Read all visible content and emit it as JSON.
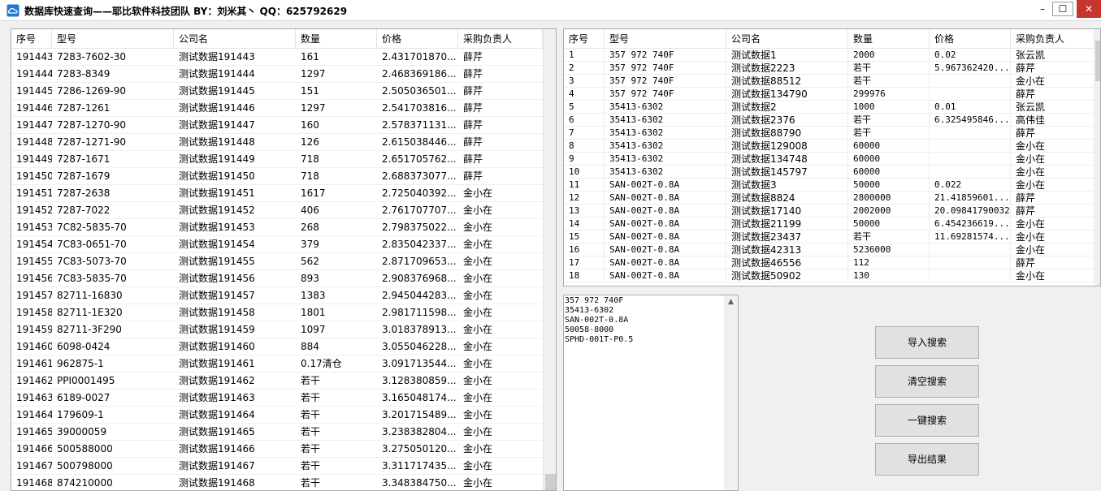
{
  "window": {
    "title": "数据库快速查询——耶比软件科技团队 BY：刘米其丶 QQ：625792629",
    "minimize": "–",
    "maximize": "☐",
    "close": "✕"
  },
  "left_grid": {
    "columns": [
      "序号",
      "型号",
      "公司名",
      "数量",
      "价格",
      "采购负责人"
    ],
    "rows": [
      [
        "191443",
        "7283-7602-30",
        "测试数据191443",
        "161",
        "2.431701870...",
        "薛芹"
      ],
      [
        "191444",
        "7283-8349",
        "测试数据191444",
        "1297",
        "2.468369186...",
        "薛芹"
      ],
      [
        "191445",
        "7286-1269-90",
        "测试数据191445",
        "151",
        "2.505036501...",
        "薛芹"
      ],
      [
        "191446",
        "7287-1261",
        "测试数据191446",
        "1297",
        "2.541703816...",
        "薛芹"
      ],
      [
        "191447",
        "7287-1270-90",
        "测试数据191447",
        "160",
        "2.578371131...",
        "薛芹"
      ],
      [
        "191448",
        "7287-1271-90",
        "测试数据191448",
        "126",
        "2.615038446...",
        "薛芹"
      ],
      [
        "191449",
        "7287-1671",
        "测试数据191449",
        "718",
        "2.651705762...",
        "薛芹"
      ],
      [
        "191450",
        "7287-1679",
        "测试数据191450",
        "718",
        "2.688373077...",
        "薛芹"
      ],
      [
        "191451",
        "7287-2638",
        "测试数据191451",
        "1617",
        "2.725040392...",
        "金小在"
      ],
      [
        "191452",
        "7287-7022",
        "测试数据191452",
        "406",
        "2.761707707...",
        "金小在"
      ],
      [
        "191453",
        "7C82-5835-70",
        "测试数据191453",
        "268",
        "2.798375022...",
        "金小在"
      ],
      [
        "191454",
        "7C83-0651-70",
        "测试数据191454",
        "379",
        "2.835042337...",
        "金小在"
      ],
      [
        "191455",
        "7C83-5073-70",
        "测试数据191455",
        "562",
        "2.871709653...",
        "金小在"
      ],
      [
        "191456",
        "7C83-5835-70",
        "测试数据191456",
        "893",
        "2.908376968...",
        "金小在"
      ],
      [
        "191457",
        "82711-16830",
        "测试数据191457",
        "1383",
        "2.945044283...",
        "金小在"
      ],
      [
        "191458",
        "82711-1E320",
        "测试数据191458",
        "1801",
        "2.981711598...",
        "金小在"
      ],
      [
        "191459",
        "82711-3F290",
        "测试数据191459",
        "1097",
        "3.018378913...",
        "金小在"
      ],
      [
        "191460",
        "6098-0424",
        "测试数据191460",
        "884",
        "3.055046228...",
        "金小在"
      ],
      [
        "191461",
        "962875-1",
        "测试数据191461",
        "0.17清仓",
        "3.091713544...",
        "金小在"
      ],
      [
        "191462",
        "PPI0001495",
        "测试数据191462",
        "若干",
        "3.128380859...",
        "金小在"
      ],
      [
        "191463",
        "6189-0027",
        "测试数据191463",
        "若干",
        "3.165048174...",
        "金小在"
      ],
      [
        "191464",
        "179609-1",
        "测试数据191464",
        "若干",
        "3.201715489...",
        "金小在"
      ],
      [
        "191465",
        "39000059",
        "测试数据191465",
        "若干",
        "3.238382804...",
        "金小在"
      ],
      [
        "191466",
        "500588000",
        "测试数据191466",
        "若干",
        "3.275050120...",
        "金小在"
      ],
      [
        "191467",
        "500798000",
        "测试数据191467",
        "若干",
        "3.311717435...",
        "金小在"
      ],
      [
        "191468",
        "874210000",
        "测试数据191468",
        "若干",
        "3.348384750...",
        "金小在"
      ]
    ]
  },
  "right_grid": {
    "columns": [
      "序号",
      "型号",
      "公司名",
      "数量",
      "价格",
      "采购负责人"
    ],
    "rows": [
      [
        "1",
        "357 972 740F",
        "测试数据1",
        "2000",
        "0.02",
        "张云凯"
      ],
      [
        "2",
        "357 972 740F",
        "测试数据2223",
        "若干",
        "5.967362420...",
        "薛芹"
      ],
      [
        "3",
        "357 972 740F",
        "测试数据88512",
        "若干",
        "",
        "金小在"
      ],
      [
        "4",
        "357 972 740F",
        "测试数据134790",
        "299976",
        "",
        "薛芹"
      ],
      [
        "5",
        "35413-6302",
        "测试数据2",
        "1000",
        "0.01",
        "张云凯"
      ],
      [
        "6",
        "35413-6302",
        "测试数据2376",
        "若干",
        "6.325495846...",
        "高伟佳"
      ],
      [
        "7",
        "35413-6302",
        "测试数据88790",
        "若干",
        "",
        "薛芹"
      ],
      [
        "8",
        "35413-6302",
        "测试数据129008",
        "60000",
        "",
        "金小在"
      ],
      [
        "9",
        "35413-6302",
        "测试数据134748",
        "60000",
        "",
        "金小在"
      ],
      [
        "10",
        "35413-6302",
        "测试数据145797",
        "60000",
        "",
        "金小在"
      ],
      [
        "11",
        "SAN-002T-0.8A",
        "测试数据3",
        "50000",
        "0.022",
        "金小在"
      ],
      [
        "12",
        "SAN-002T-0.8A",
        "测试数据8824",
        "2800000",
        "21.41859601...",
        "薛芹"
      ],
      [
        "13",
        "SAN-002T-0.8A",
        "测试数据17140",
        "2002000",
        "20.09841790032",
        "薛芹"
      ],
      [
        "14",
        "SAN-002T-0.8A",
        "测试数据21199",
        "50000",
        "6.454236619...",
        "金小在"
      ],
      [
        "15",
        "SAN-002T-0.8A",
        "测试数据23437",
        "若干",
        "11.69281574...",
        "金小在"
      ],
      [
        "16",
        "SAN-002T-0.8A",
        "测试数据42313",
        "5236000",
        "",
        "金小在"
      ],
      [
        "17",
        "SAN-002T-0.8A",
        "测试数据46556",
        "112",
        "",
        "薛芹"
      ],
      [
        "18",
        "SAN-002T-0.8A",
        "测试数据50902",
        "130",
        "",
        "金小在"
      ]
    ]
  },
  "search_input": {
    "lines": [
      "357 972 740F",
      "35413-6302",
      "SAN-002T-0.8A",
      "50058-8000",
      "SPHD-001T-P0.5"
    ]
  },
  "buttons": {
    "import_search": "导入搜索",
    "clear_search": "清空搜索",
    "one_click_search": "一键搜索",
    "export_results": "导出结果"
  },
  "colors": {
    "close_button": "#c7362c",
    "title_accent": "#1e7ad6"
  },
  "icons": {
    "app": "cloud-icon",
    "scroll_up": "chevron-up-icon"
  }
}
